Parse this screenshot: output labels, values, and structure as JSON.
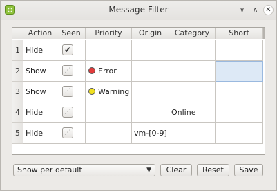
{
  "window": {
    "title": "Message Filter",
    "buttons": {
      "minimize": "∨",
      "maximize": "∧",
      "close": "✕"
    }
  },
  "table": {
    "columns": [
      "Action",
      "Seen",
      "Priority",
      "Origin",
      "Category",
      "Short"
    ],
    "rows": [
      {
        "num": "1",
        "action": "Hide",
        "seen": "checked",
        "priority": "",
        "priority_color": "",
        "origin": "",
        "category": "",
        "short": ""
      },
      {
        "num": "2",
        "action": "Show",
        "seen": "partial",
        "priority": "Error",
        "priority_color": "#e23b3b",
        "origin": "",
        "category": "",
        "short": ""
      },
      {
        "num": "3",
        "action": "Show",
        "seen": "partial",
        "priority": "Warning",
        "priority_color": "#f0e020",
        "origin": "",
        "category": "",
        "short": ""
      },
      {
        "num": "4",
        "action": "Hide",
        "seen": "partial",
        "priority": "",
        "priority_color": "",
        "origin": "",
        "category": "Online",
        "short": ""
      },
      {
        "num": "5",
        "action": "Hide",
        "seen": "partial",
        "priority": "",
        "priority_color": "",
        "origin": "vm-[0-9]",
        "category": "",
        "short": ""
      }
    ]
  },
  "footer": {
    "default_mode": "Show per default",
    "clear_label": "Clear",
    "reset_label": "Reset",
    "save_label": "Save"
  }
}
